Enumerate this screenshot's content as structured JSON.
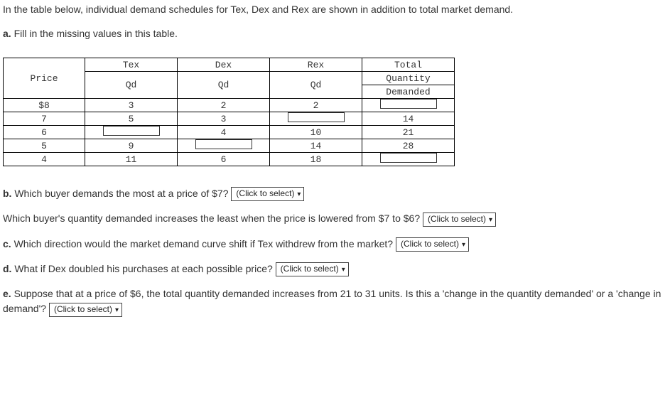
{
  "intro": "In the table below, individual demand schedules for Tex, Dex and Rex are shown in addition to total market demand.",
  "part_a_label": "a.",
  "part_a_text": "Fill in the missing values in this table.",
  "table": {
    "headers": {
      "price": "Price",
      "tex_top": "Tex",
      "tex_bot": "Qd",
      "dex_top": "Dex",
      "dex_bot": "Qd",
      "rex_top": "Rex",
      "rex_bot": "Qd",
      "total_top": "Total",
      "total_mid": "Quantity",
      "total_bot": "Demanded"
    },
    "rows": [
      {
        "price": "$8",
        "tex": "3",
        "dex": "2",
        "rex": "2",
        "total": null
      },
      {
        "price": "7",
        "tex": "5",
        "dex": "3",
        "rex": null,
        "total": "14"
      },
      {
        "price": "6",
        "tex": null,
        "dex": "4",
        "rex": "10",
        "total": "21"
      },
      {
        "price": "5",
        "tex": "9",
        "dex": null,
        "rex": "14",
        "total": "28"
      },
      {
        "price": "4",
        "tex": "11",
        "dex": "6",
        "rex": "18",
        "total": null
      }
    ]
  },
  "select_placeholder": "(Click to select)",
  "b": {
    "label": "b.",
    "q1": "Which buyer demands the most at a price of $7?",
    "q2": "Which buyer's quantity demanded increases the least when the price is lowered from $7 to $6?"
  },
  "c": {
    "label": "c.",
    "q": "Which direction would the market demand curve shift if Tex withdrew from the market?"
  },
  "d": {
    "label": "d.",
    "q": "What if Dex doubled his purchases at each possible price?"
  },
  "e": {
    "label": "e.",
    "q": "Suppose that at a price of $6, the total quantity demanded increases from 21 to 31 units. Is this a 'change in the quantity demanded' or a 'change in demand'?"
  }
}
